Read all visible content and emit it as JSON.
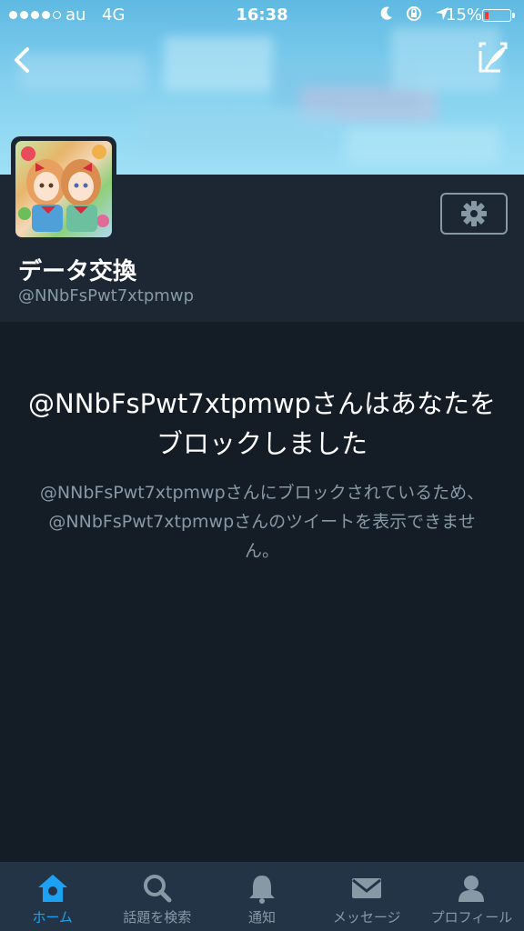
{
  "status_bar": {
    "carrier": "au",
    "network": "4G",
    "time": "16:38",
    "battery_percent": "15%",
    "battery_level": 0.15
  },
  "profile": {
    "display_name": "データ交換",
    "handle": "@NNbFsPwt7xtpmwp"
  },
  "blocked": {
    "title": "@NNbFsPwt7xtpmwpさんはあなたをブロックしました",
    "description": "@NNbFsPwt7xtpmwpさんにブロックされているため、@NNbFsPwt7xtpmwpさんのツイートを表示できません。"
  },
  "tabs": [
    {
      "label": "ホーム",
      "icon": "home-icon",
      "active": true
    },
    {
      "label": "話題を検索",
      "icon": "search-icon",
      "active": false
    },
    {
      "label": "通知",
      "icon": "bell-icon",
      "active": false
    },
    {
      "label": "メッセージ",
      "icon": "envelope-icon",
      "active": false
    },
    {
      "label": "プロフィール",
      "icon": "person-icon",
      "active": false
    }
  ],
  "colors": {
    "background": "#141d26",
    "header": "#1c2733",
    "tabbar": "#243447",
    "accent": "#1da1f2",
    "muted": "#8899a6"
  }
}
